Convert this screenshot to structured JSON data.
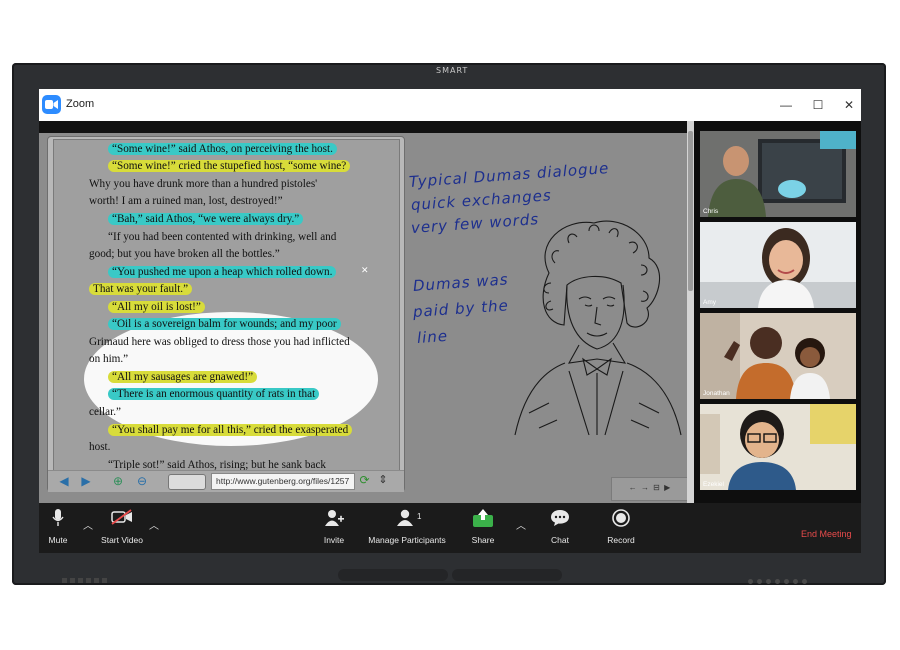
{
  "monitor": {
    "brand": "SMART"
  },
  "window": {
    "title": "Zoom",
    "controls": {
      "minimize": "—",
      "maximize": "☐",
      "close": "✕"
    }
  },
  "book": {
    "lines": [
      "“Some wine!” said Athos, on perceiving the host.",
      "“Some wine!” cried the stupefied host, “some wine?",
      "Why you have drunk more than a hundred pistoles'",
      "worth! I am a ruined man, lost, destroyed!”",
      "“Bah,” said Athos, “we were always dry.”",
      "“If you had been contented with drinking, well and",
      "good; but you have broken all the bottles.”",
      "“You pushed me upon a heap which rolled down.",
      "That was your fault.”",
      "“All my oil is lost!”",
      "“Oil is a sovereign balm for wounds; and my poor",
      "Grimaud here was obliged to dress those you had inflicted",
      "on him.”",
      "“All my sausages are gnawed!”",
      "“There is an enormous quantity of rats in that",
      "cellar.”",
      "“You shall pay me for all this,” cried the exasperated",
      "host.",
      "“Triple sot!” said Athos, rising; but he sank back"
    ]
  },
  "browser": {
    "url": "http://www.gutenberg.org/files/1257"
  },
  "annotations": {
    "note1": [
      "Typical Dumas dialogue",
      "quick exchanges",
      "very few words"
    ],
    "note2": [
      "Dumas was",
      "paid by the",
      "line"
    ]
  },
  "mini_toolbar": {
    "icons": "← → ⊟ ▶"
  },
  "participants": [
    {
      "name": "Chris"
    },
    {
      "name": "Amy"
    },
    {
      "name": "Jonathan"
    },
    {
      "name": "Ezekiel"
    }
  ],
  "toolbar": {
    "mute": "Mute",
    "start_video": "Start Video",
    "invite": "Invite",
    "manage_participants": "Manage Participants",
    "participant_count": "1",
    "share": "Share",
    "chat": "Chat",
    "record": "Record",
    "end_meeting": "End Meeting"
  },
  "colors": {
    "zoom_blue": "#2d8cff",
    "highlight_yellow": "#d8dc3a",
    "highlight_cyan": "#39c9c6",
    "ink_blue": "#1d2f8e",
    "share_green": "#3bb14a",
    "end_red": "#e84b4b"
  }
}
